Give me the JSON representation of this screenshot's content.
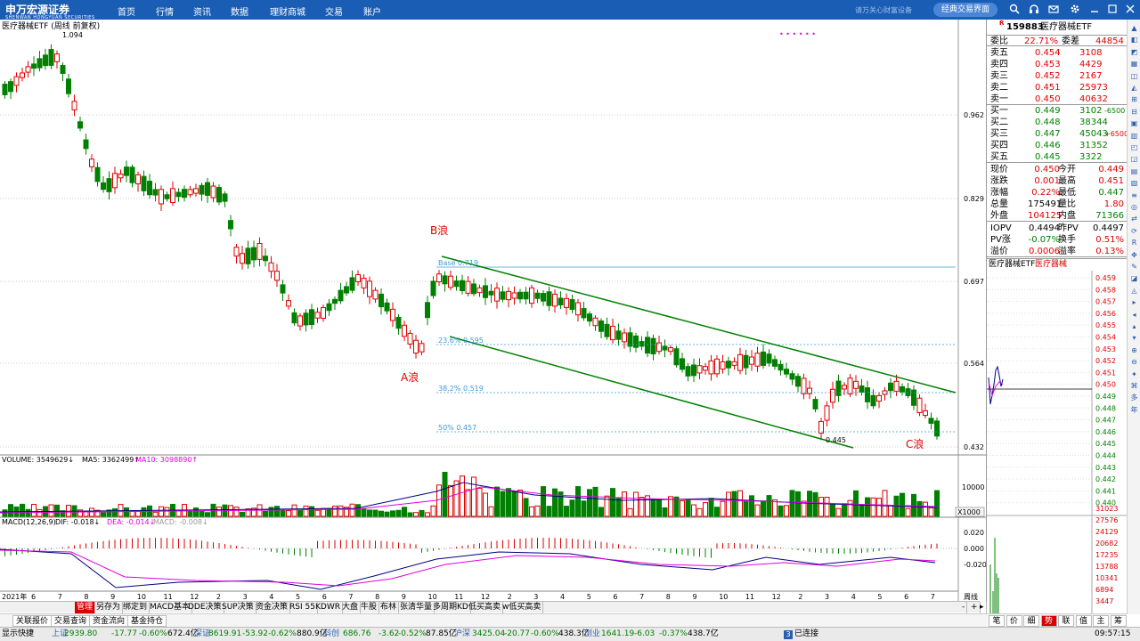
{
  "topbar": {
    "brand": "申万宏源证券",
    "brand_en": "SHENWAN HONGYUAN SECURITIES",
    "nav": [
      "首页",
      "行情",
      "资讯",
      "数据",
      "理财商城",
      "交易",
      "账户"
    ],
    "login_hint": "请万关心财富设备",
    "classic_button": "经典交易界面"
  },
  "chart": {
    "title": "医疗器械ETF (周线 前复权)",
    "max_label": "1.094",
    "price_ticks": [
      "0.962",
      "0.829",
      "0.697",
      "0.564",
      "0.432"
    ],
    "wave_B": "B浪",
    "wave_A": "A浪",
    "wave_C": "C浪",
    "fib_base": "Base 0.719",
    "fib_236": "23.6% 0.595",
    "fib_382": "38.2% 0.519",
    "fib_50": "50% 0.457",
    "low_label": "0.445",
    "dots": "• • •   •   • •"
  },
  "volume": {
    "title": "VOLUME: 3549629↓",
    "ma5": "MA5: 3362499↑",
    "ma10": "MA10: 3098890↑",
    "tick": "10000",
    "unit": "X1000"
  },
  "macd": {
    "title": "MACD(12,26,9)",
    "dif": "DIF: -0.018↓",
    "dea": "DEA: -0.014↓",
    "macd": "MACD: -0.008↓",
    "ticks": [
      "0.020",
      "0.000",
      "-0.020"
    ]
  },
  "time_axis": {
    "year_label": "2021年",
    "months": [
      "6",
      "7",
      "8",
      "9",
      "10",
      "11",
      "12",
      "2",
      "3",
      "4",
      "5",
      "6",
      "7",
      "8",
      "9",
      "10",
      "11",
      "12",
      "2",
      "3",
      "4",
      "5",
      "6",
      "7",
      "8",
      "9",
      "10",
      "11",
      "12",
      "2",
      "3",
      "4",
      "5",
      "6",
      "7"
    ],
    "corner_label": "周线"
  },
  "quote": {
    "code": "159883",
    "name": "医疗器械ETF",
    "r_mark": "R",
    "wb": {
      "label": "委比",
      "value": "22.71%",
      "diff_label": "委差",
      "diff": "44854"
    },
    "asks": [
      {
        "label": "卖五",
        "price": "0.454",
        "vol": "3108"
      },
      {
        "label": "卖四",
        "price": "0.453",
        "vol": "4429"
      },
      {
        "label": "卖三",
        "price": "0.452",
        "vol": "2167"
      },
      {
        "label": "卖二",
        "price": "0.451",
        "vol": "25973"
      },
      {
        "label": "卖一",
        "price": "0.450",
        "vol": "40632"
      }
    ],
    "bids": [
      {
        "label": "买一",
        "price": "0.449",
        "vol": "3102",
        "chg": "-6500"
      },
      {
        "label": "买二",
        "price": "0.448",
        "vol": "38344",
        "chg": ""
      },
      {
        "label": "买三",
        "price": "0.447",
        "vol": "45043",
        "chg": "+6500"
      },
      {
        "label": "买四",
        "price": "0.446",
        "vol": "31352",
        "chg": ""
      },
      {
        "label": "买五",
        "price": "0.445",
        "vol": "3322",
        "chg": ""
      }
    ],
    "stats": [
      {
        "l1": "现价",
        "v1": "0.450",
        "l2": "今开",
        "v2": "0.449"
      },
      {
        "l1": "涨跌",
        "v1": "0.001",
        "l2": "最高",
        "v2": "0.451"
      },
      {
        "l1": "涨幅",
        "v1": "0.22%",
        "l2": "最低",
        "v2": "0.447"
      },
      {
        "l1": "总量",
        "v1": "175491",
        "l2": "量比",
        "v2": "1.80"
      },
      {
        "l1": "外盘",
        "v1": "104125",
        "l2": "内盘",
        "v2": "71366"
      }
    ],
    "iopv": [
      {
        "l1": "IOPV",
        "v1": "0.4494",
        "l2": "昨PV",
        "v2": "0.4497"
      },
      {
        "l1": "PV涨",
        "v1": "-0.07%",
        "l2": "换手",
        "v2": "0.51%"
      },
      {
        "l1": "溢价",
        "v1": "0.0006",
        "l2": "溢率",
        "v2": "0.13%"
      }
    ],
    "mini_tab1": "医疗器械ETF",
    "mini_tab2": "医疗器械",
    "mini_ticks": [
      "0.459",
      "0.458",
      "0.457",
      "0.456",
      "0.455",
      "0.454",
      "0.453",
      "0.452",
      "0.451",
      "0.450",
      "0.449",
      "0.448",
      "0.447",
      "0.446",
      "0.445",
      "0.444",
      "0.443",
      "0.442",
      "0.441",
      "0.440"
    ],
    "mini_vol_ticks": [
      "31023",
      "27576",
      "24129",
      "20682",
      "17235",
      "13788",
      "10341",
      "6894",
      "3447"
    ],
    "rp_tabs": [
      "笔",
      "价",
      "细",
      "势",
      "联",
      "值",
      "主",
      "筹"
    ],
    "rp_active": 3
  },
  "period_tabs": [
    "管理",
    "另存为",
    "绑定到",
    "MACD基本",
    "DDE决策",
    "SUP决策",
    "资金决策",
    "RSI 55",
    "KDWR",
    "大盘",
    "牛股",
    "布林",
    "张清华量",
    "多周期KD",
    "低买高卖",
    "w低买高卖"
  ],
  "period_active": 0,
  "bottom_tabs": [
    "关联报价",
    "交易查询",
    "资金流向",
    "基金持仓"
  ],
  "status": {
    "label": "显示快捷",
    "sh": "上证",
    "sh_v": "2939.80",
    "sh_c": "-17.77",
    "sh_p": "-0.60%",
    "sh_a": "672.4亿",
    "sz": "深证",
    "sz_v": "8619.91",
    "sz_c": "-53.92",
    "sz_p": "-0.62%",
    "sz_a": "880.9亿",
    "kc": "科创",
    "kc_v": "686.76",
    "kc_c": "-3.62",
    "kc_p": "-0.52%",
    "kc_a": "87.85亿",
    "hs": "沪深",
    "hs_v": "3425.04",
    "hs_c": "-20.77",
    "hs_p": "-0.60%",
    "hs_a": "438.3亿",
    "cy": "创业",
    "cy_v": "1641.19",
    "cy_c": "-6.03",
    "cy_p": "-0.37%",
    "cy_a": "438.7亿",
    "conn": "已连接",
    "conn_n": "3",
    "time": "09:57:15"
  },
  "colors": {
    "up": "#e00000",
    "down": "#008000",
    "bg": "#ffffff",
    "nav": "#1a5db5",
    "trend": "#008000",
    "fib": "#3c9ad8",
    "dif": "#000080",
    "dea": "#e000e0"
  },
  "icons": [
    "search-icon",
    "bell-icon",
    "headset-icon",
    "mail-icon",
    "gear-icon",
    "minimize-icon",
    "maximize-icon",
    "close-icon"
  ]
}
